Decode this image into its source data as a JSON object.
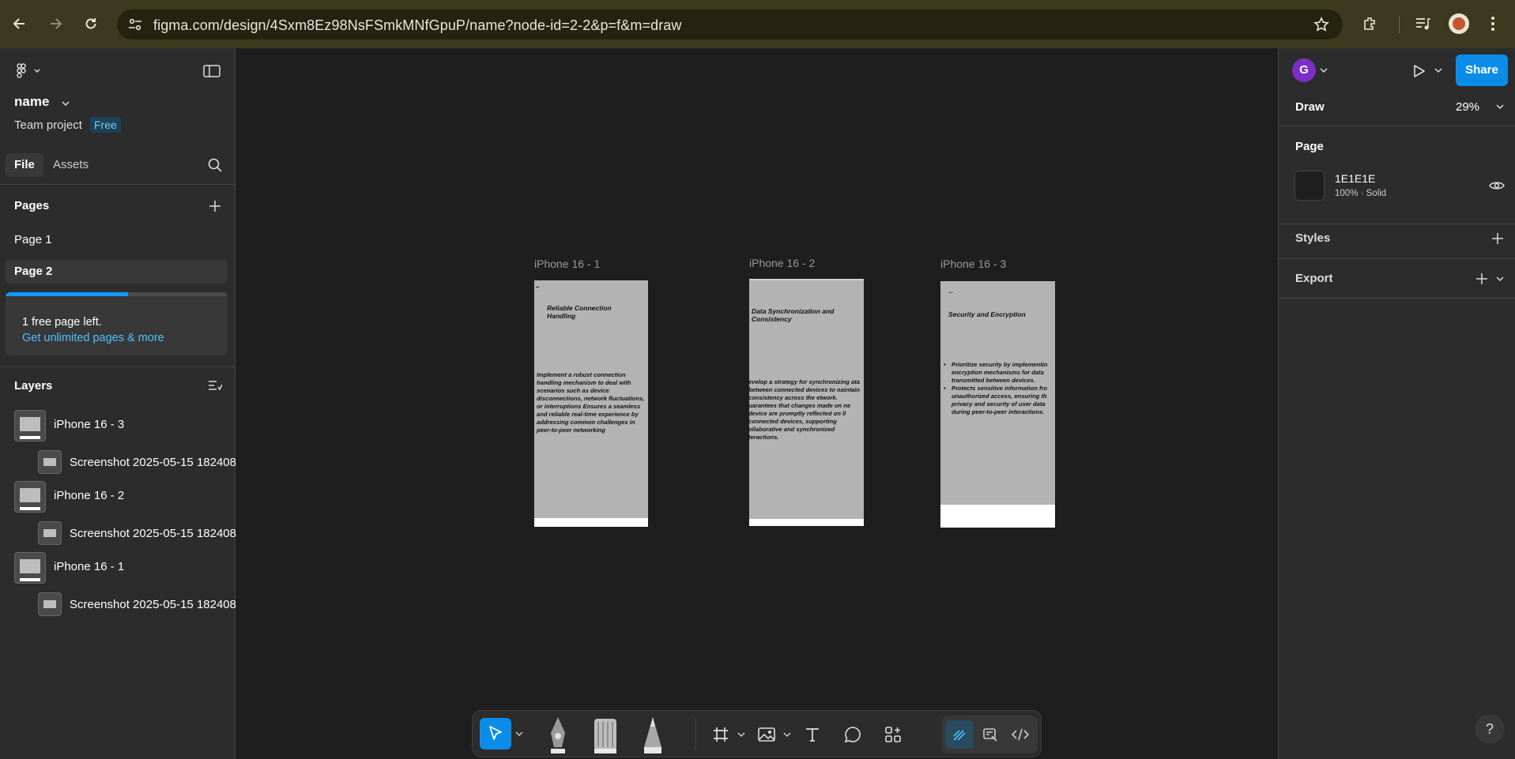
{
  "browser": {
    "url": "figma.com/design/4Sxm8Ez98NsFSmkMNfGpuP/name?node-id=2-2&p=f&m=draw",
    "icons": [
      "back-icon",
      "forward-icon",
      "reload-icon",
      "site-settings-icon",
      "bookmark-star-icon",
      "extensions-icon",
      "media-control-icon",
      "profile-avatar-icon"
    ]
  },
  "left_panel": {
    "file_name": "name",
    "team_label": "Team project",
    "plan_badge": "Free",
    "tabs": [
      {
        "label": "File"
      },
      {
        "label": "Assets"
      }
    ],
    "pages_title": "Pages",
    "pages": [
      {
        "label": "Page 1",
        "selected": false
      },
      {
        "label": "Page 2",
        "selected": true
      }
    ],
    "upsell": {
      "text": "1 free page left.",
      "link": "Get unlimited pages & more",
      "usage_fraction": 0.55
    },
    "layers_title": "Layers",
    "layers": [
      {
        "label": "iPhone 16 - 3",
        "type": "frame"
      },
      {
        "label": "Screenshot 2025-05-15 182408",
        "type": "image"
      },
      {
        "label": "iPhone 16 - 2",
        "type": "frame"
      },
      {
        "label": "Screenshot 2025-05-15 182408",
        "type": "image"
      },
      {
        "label": "iPhone 16 - 1",
        "type": "frame"
      },
      {
        "label": "Screenshot 2025-05-15 182408",
        "type": "image"
      }
    ]
  },
  "canvas": {
    "background": "#1E1E1E",
    "frames": [
      {
        "title": "iPhone 16 - 1",
        "heading": "Reliable Connection Handling",
        "body": "Implement a robust connection handling mechanism to deal with scenarios such as device disconnections, network fluctuations, or interruptions Ensures a seamless and reliable real-time experience by addressing common challenges in peer-to-peer networking"
      },
      {
        "title": "iPhone 16 - 2",
        "heading": "Data Synchronization and Consistency",
        "body": "evelop a strategy for synchronizing ata between connected devices to naintain consistency across the etwork. uarantees that changes made on ne device are promptly reflected on ll connected devices, supporting ollaborative and synchronized teractions."
      },
      {
        "title": "iPhone 16 - 3",
        "back_glyph": "←",
        "heading": "Security and Encryption",
        "bullets": [
          "Prioritize security by implementin encryption mechanisms for data transmitted between devices.",
          "Protects sensitive information fro unauthorized access, ensuring th privacy and security of user data during peer-to-peer interactions."
        ]
      }
    ]
  },
  "toolbar": {
    "tools": [
      "move-tool",
      "pen-tool",
      "marker-tool",
      "pencil-tool",
      "frame-tool",
      "image-tool",
      "text-tool",
      "comment-tool",
      "actions-tool",
      "draw-mode",
      "design-mode",
      "dev-mode"
    ],
    "active_tool": "move-tool"
  },
  "right_panel": {
    "avatar_initial": "G",
    "share_label": "Share",
    "mode_label": "Draw",
    "zoom": "29%",
    "page_section": "Page",
    "page_color_hex": "1E1E1E",
    "page_color_sub": "100% · Solid",
    "styles_section": "Styles",
    "export_section": "Export",
    "help_label": "?"
  }
}
